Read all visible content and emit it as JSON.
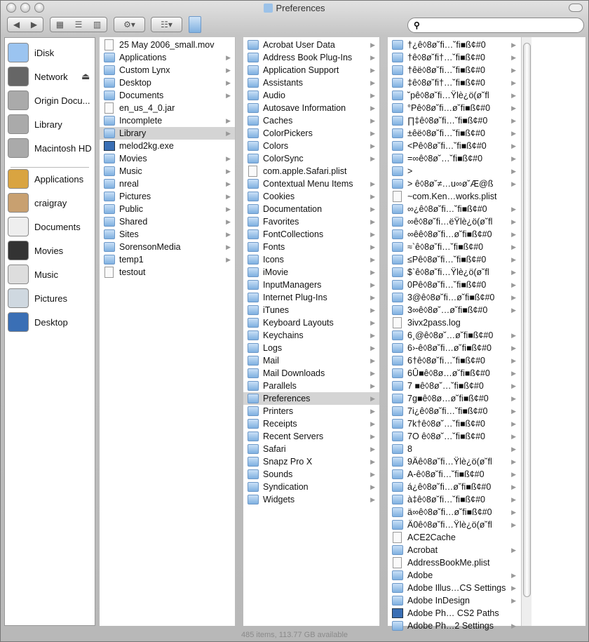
{
  "window": {
    "title": "Preferences",
    "status": "485 items, 113.77 GB available"
  },
  "toolbar": {
    "back": "◀",
    "forward": "▶",
    "view_icon": "▦",
    "view_list": "☰",
    "view_column": "▥",
    "action": "⚙▾",
    "arrange": "☷▾",
    "search_placeholder": "",
    "search_icon": "search-icon"
  },
  "sidebar": {
    "devices": [
      {
        "label": "iDisk",
        "icon": "idisk-icon"
      },
      {
        "label": "Network",
        "icon": "network-icon",
        "eject": "⏏"
      },
      {
        "label": "Origin Docu...",
        "icon": "disk-icon"
      },
      {
        "label": "Library",
        "icon": "disk-icon"
      },
      {
        "label": "Macintosh HD",
        "icon": "disk-icon"
      }
    ],
    "places": [
      {
        "label": "Applications",
        "icon": "applications-icon"
      },
      {
        "label": "craigray",
        "icon": "home-icon"
      },
      {
        "label": "Documents",
        "icon": "documents-icon"
      },
      {
        "label": "Movies",
        "icon": "movies-icon"
      },
      {
        "label": "Music",
        "icon": "music-icon"
      },
      {
        "label": "Pictures",
        "icon": "pictures-icon"
      },
      {
        "label": "Desktop",
        "icon": "desktop-icon"
      }
    ]
  },
  "columns": [
    {
      "selected": "Library",
      "items": [
        [
          "25 May 2006_small.mov",
          "file",
          0
        ],
        [
          "Applications",
          "folder",
          1
        ],
        [
          "Custom Lynx",
          "folder",
          1
        ],
        [
          "Desktop",
          "folder",
          1
        ],
        [
          "Documents",
          "folder",
          1
        ],
        [
          "en_us_4_0.jar",
          "file",
          0
        ],
        [
          "Incomplete",
          "folder",
          1
        ],
        [
          "Library",
          "folder",
          1
        ],
        [
          "melod2kg.exe",
          "app",
          0
        ],
        [
          "Movies",
          "folder",
          1
        ],
        [
          "Music",
          "folder",
          1
        ],
        [
          "nreal",
          "folder",
          1
        ],
        [
          "Pictures",
          "folder",
          1
        ],
        [
          "Public",
          "folder",
          1
        ],
        [
          "Shared",
          "folder",
          1
        ],
        [
          "Sites",
          "folder",
          1
        ],
        [
          "SorensonMedia",
          "folder",
          1
        ],
        [
          "temp1",
          "folder",
          1
        ],
        [
          "testout",
          "file",
          0
        ]
      ]
    },
    {
      "selected": "Preferences",
      "items": [
        [
          "Acrobat User Data",
          "folder",
          1
        ],
        [
          "Address Book Plug-Ins",
          "folder",
          1
        ],
        [
          "Application Support",
          "folder",
          1
        ],
        [
          "Assistants",
          "folder",
          1
        ],
        [
          "Audio",
          "folder",
          1
        ],
        [
          "Autosave Information",
          "folder",
          1
        ],
        [
          "Caches",
          "folder",
          1
        ],
        [
          "ColorPickers",
          "folder",
          1
        ],
        [
          "Colors",
          "folder",
          1
        ],
        [
          "ColorSync",
          "folder",
          1
        ],
        [
          "com.apple.Safari.plist",
          "file",
          0
        ],
        [
          "Contextual Menu Items",
          "folder",
          1
        ],
        [
          "Cookies",
          "folder",
          1
        ],
        [
          "Documentation",
          "folder",
          1
        ],
        [
          "Favorites",
          "folder",
          1
        ],
        [
          "FontCollections",
          "folder",
          1
        ],
        [
          "Fonts",
          "folder",
          1
        ],
        [
          "Icons",
          "folder",
          1
        ],
        [
          "iMovie",
          "folder",
          1
        ],
        [
          "InputManagers",
          "folder",
          1
        ],
        [
          "Internet Plug-Ins",
          "folder",
          1
        ],
        [
          "iTunes",
          "folder",
          1
        ],
        [
          "Keyboard Layouts",
          "folder",
          1
        ],
        [
          "Keychains",
          "folder",
          1
        ],
        [
          "Logs",
          "folder",
          1
        ],
        [
          "Mail",
          "folder",
          1
        ],
        [
          "Mail Downloads",
          "folder",
          1
        ],
        [
          "Parallels",
          "folder",
          1
        ],
        [
          "Preferences",
          "folder",
          1
        ],
        [
          "Printers",
          "folder",
          1
        ],
        [
          "Receipts",
          "folder",
          1
        ],
        [
          "Recent Servers",
          "folder",
          1
        ],
        [
          "Safari",
          "folder",
          1
        ],
        [
          "Snapz Pro X",
          "folder",
          1
        ],
        [
          "Sounds",
          "folder",
          1
        ],
        [
          "Syndication",
          "folder",
          1
        ],
        [
          "Widgets",
          "folder",
          1
        ]
      ]
    },
    {
      "selected": "",
      "items": [
        [
          "†¿ê◊8ø˘fi…˘fi■ß¢#0",
          "folder",
          1
        ],
        [
          "†ê◊8ø˘fi†…˘fi■ß¢#0",
          "folder",
          1
        ],
        [
          "†êë◊8ø˘fi…˘fi■ß¢#0",
          "folder",
          1
        ],
        [
          "‡ê◊8ø˘fi†…˘fi■ß¢#0",
          "folder",
          1
        ],
        [
          "˘pê◊8ø˘fi…Ÿlè¿ö(ø˘fl",
          "folder",
          1
        ],
        [
          "°Pê◊8ø˘fi…ø˘fi■ß¢#0",
          "folder",
          1
        ],
        [
          "∏‡ê◊8ø˘fi…˘fi■ß¢#0",
          "folder",
          1
        ],
        [
          "±êë◊8ø˘fi…˘fi■ß¢#0",
          "folder",
          1
        ],
        [
          "<Pê◊8ø˘fi…˘fi■ß¢#0",
          "folder",
          1
        ],
        [
          "=∞ê◊8ø˘…˘fi■ß¢#0",
          "folder",
          1
        ],
        [
          ">",
          "folder",
          1
        ],
        [
          "> ê◊8ø˘≠…u∞ø˘Æ@ß",
          "folder",
          1
        ],
        [
          "~com.Ken…works.plist",
          "file",
          0
        ],
        [
          "∞¿ê◊8ø˘fi…˘fi■ß¢#0",
          "folder",
          1
        ],
        [
          "∞ê◊8ø˘fi…ëŸlè¿ö(ø˘fl",
          "folder",
          1
        ],
        [
          "∞êê◊8ø˘fi…ø˘fi■ß¢#0",
          "folder",
          1
        ],
        [
          "≈`ê◊8ø˘fi…˘fi■ß¢#0",
          "folder",
          1
        ],
        [
          "≤Pê◊8ø˘fi…˘fi■ß¢#0",
          "folder",
          1
        ],
        [
          "$`ê◊8ø˘fi…Ÿlè¿ö(ø˘fl",
          "folder",
          1
        ],
        [
          "0Pê◊8ø˘fi…˘fi■ß¢#0",
          "folder",
          1
        ],
        [
          "3@ê◊8ø˘fi…ø˘fi■ß¢#0",
          "folder",
          1
        ],
        [
          "3∞ê◊8ø˘…ø˘fi■ß¢#0",
          "folder",
          1
        ],
        [
          "3ivx2pass.log",
          "file",
          0
        ],
        [
          "6¸@ê◊8ø˘…ø˘fi■ß¢#0",
          "folder",
          1
        ],
        [
          "6›-ê◊8ø˘fi…ø˘fi■ß¢#0",
          "folder",
          1
        ],
        [
          "6†ê◊8ø˘fi…˘fi■ß¢#0",
          "folder",
          1
        ],
        [
          "6Û■ê◊8ø…ø˘fi■ß¢#0",
          "folder",
          1
        ],
        [
          "7 ■ê◊8ø˘…˘fi■ß¢#0",
          "folder",
          1
        ],
        [
          "7g■ê◊8ø…ø˘fi■ß¢#0",
          "folder",
          1
        ],
        [
          "7i¿ê◊8ø˘fi…˘fi■ß¢#0",
          "folder",
          1
        ],
        [
          "7k†ê◊8ø˘…˘fi■ß¢#0",
          "folder",
          1
        ],
        [
          "7O ê◊8ø˘…˘fi■ß¢#0",
          "folder",
          1
        ],
        [
          "8",
          "folder",
          1
        ],
        [
          "9Äê◊8ø˘fi…Ÿlè¿ö(ø˘fl",
          "folder",
          1
        ],
        [
          "A-ê◊8ø˘fi…˘fi■ß¢#0",
          "folder",
          1
        ],
        [
          "á¿ê◊8ø˘fi…ø˘fi■ß¢#0",
          "folder",
          1
        ],
        [
          "à‡ê◊8ø˘fi…˘fi■ß¢#0",
          "folder",
          1
        ],
        [
          "ä∞ê◊8ø˘fi…ø˘fi■ß¢#0",
          "folder",
          1
        ],
        [
          "Ä0ê◊8ø˘fi…Ÿlè¿ö(ø˘fl",
          "folder",
          1
        ],
        [
          "ACE2Cache",
          "file",
          0
        ],
        [
          "Acrobat",
          "folder",
          1
        ],
        [
          "AddressBookMe.plist",
          "file",
          0
        ],
        [
          "Adobe",
          "folder",
          1
        ],
        [
          "Adobe Illus…CS Settings",
          "folder",
          1
        ],
        [
          "Adobe InDesign",
          "folder",
          1
        ],
        [
          "Adobe Ph… CS2 Paths",
          "app",
          0
        ],
        [
          "Adobe Ph…2 Settings",
          "folder",
          1
        ]
      ]
    }
  ]
}
